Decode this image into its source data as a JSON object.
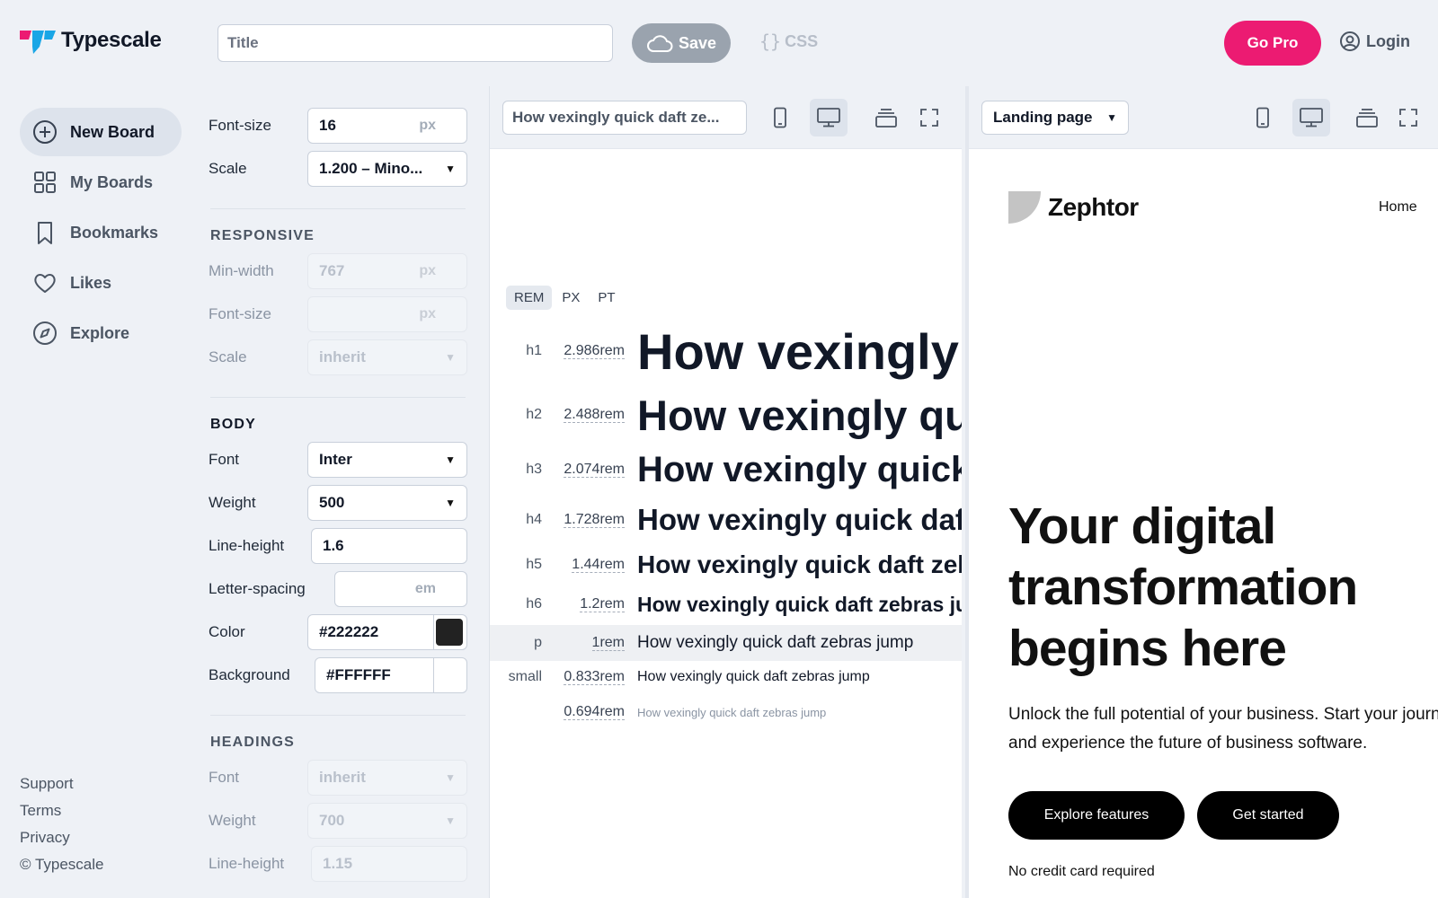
{
  "app": {
    "name": "Typescale",
    "title_placeholder": "Title",
    "save_label": "Save",
    "css_label": "CSS",
    "gopro_label": "Go Pro",
    "login_label": "Login",
    "brand_pink": "#ec1b72",
    "brand_blue": "#19a6e6"
  },
  "nav": {
    "items": [
      {
        "label": "New Board",
        "icon": "plus-circle-icon"
      },
      {
        "label": "My Boards",
        "icon": "grid-icon"
      },
      {
        "label": "Bookmarks",
        "icon": "bookmark-icon"
      },
      {
        "label": "Likes",
        "icon": "heart-icon"
      },
      {
        "label": "Explore",
        "icon": "compass-icon"
      }
    ],
    "footer": [
      "Support",
      "Terms",
      "Privacy",
      "© Typescale"
    ]
  },
  "settings": {
    "font_size": {
      "label": "Font-size",
      "value": "16",
      "unit": "px"
    },
    "scale": {
      "label": "Scale",
      "value": "1.200 – Mino..."
    },
    "responsive": {
      "title": "RESPONSIVE",
      "min_width": {
        "label": "Min-width",
        "placeholder": "767",
        "unit": "px"
      },
      "font_size": {
        "label": "Font-size",
        "unit": "px"
      },
      "scale": {
        "label": "Scale",
        "value": "inherit"
      }
    },
    "body": {
      "title": "BODY",
      "font": {
        "label": "Font",
        "value": "Inter"
      },
      "weight": {
        "label": "Weight",
        "value": "500"
      },
      "line_height": {
        "label": "Line-height",
        "value": "1.6"
      },
      "letter_spacing": {
        "label": "Letter-spacing",
        "unit": "em"
      },
      "color": {
        "label": "Color",
        "value": "#222222",
        "swatch": "#222222"
      },
      "background": {
        "label": "Background",
        "value": "#FFFFFF",
        "swatch": "#FFFFFF"
      }
    },
    "headings": {
      "title": "HEADINGS",
      "font": {
        "label": "Font",
        "value": "inherit"
      },
      "weight": {
        "label": "Weight",
        "value": "700"
      },
      "line_height": {
        "label": "Line-height",
        "value": "1.15"
      }
    }
  },
  "scale_pane": {
    "sample_text": "How vexingly quick daft ze...",
    "units": [
      "REM",
      "PX",
      "PT"
    ],
    "rows": [
      {
        "tag": "h1",
        "size": "2.986rem",
        "sample": "How vexingly quick daft zebras jump"
      },
      {
        "tag": "h2",
        "size": "2.488rem",
        "sample": "How vexingly quick daft zebras jump"
      },
      {
        "tag": "h3",
        "size": "2.074rem",
        "sample": "How vexingly quick daft zebras jump"
      },
      {
        "tag": "h4",
        "size": "1.728rem",
        "sample": "How vexingly quick daft zebras jump"
      },
      {
        "tag": "h5",
        "size": "1.44rem",
        "sample": "How vexingly quick daft zebras jump"
      },
      {
        "tag": "h6",
        "size": "1.2rem",
        "sample": "How vexingly quick daft zebras jump"
      },
      {
        "tag": "p",
        "size": "1rem",
        "sample": "How vexingly quick daft zebras jump"
      },
      {
        "tag": "small",
        "size": "0.833rem",
        "sample": "How vexingly quick daft zebras jump"
      },
      {
        "tag": "",
        "size": "0.694rem",
        "sample": "How vexingly quick daft zebras jump"
      }
    ]
  },
  "landing_pane": {
    "template": "Landing page",
    "logo": "Zephtor",
    "nav_home": "Home",
    "headline": "Your digital transformation begins here",
    "paragraph_line1": "Unlock the full potential of your business. Start your journey",
    "paragraph_line2": "and experience the future of business software.",
    "btn_explore": "Explore features",
    "btn_start": "Get started",
    "note": "No credit card required"
  }
}
